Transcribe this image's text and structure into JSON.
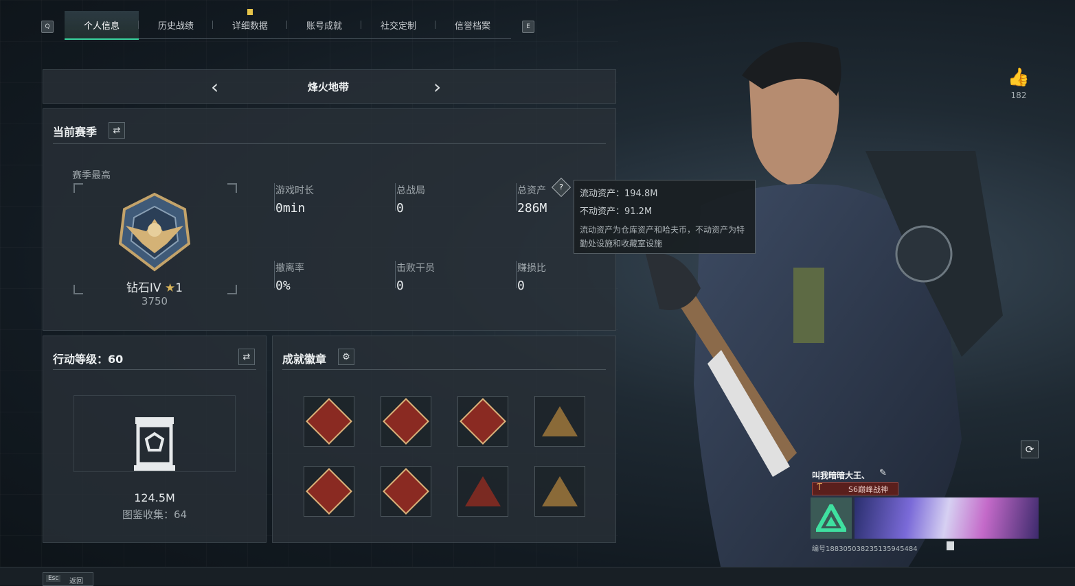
{
  "tabs": {
    "left_key": "Q",
    "right_key": "E",
    "items": [
      "个人信息",
      "历史战绩",
      "详细数据",
      "账号成就",
      "社交定制",
      "信誉档案"
    ],
    "active_index": 0
  },
  "mode_selector": {
    "title": "烽火地带"
  },
  "season": {
    "title": "当前赛季",
    "best_label": "赛季最高",
    "rank_name": "钻石IV",
    "rank_stars": "1",
    "rank_points": "3750",
    "stats": [
      {
        "label": "游戏时长",
        "value": "0min"
      },
      {
        "label": "总战局",
        "value": "0"
      },
      {
        "label": "总资产",
        "value": "286M"
      },
      {
        "label": "撤离率",
        "value": "0%"
      },
      {
        "label": "击败干员",
        "value": "0"
      },
      {
        "label": "赚损比",
        "value": "0"
      }
    ]
  },
  "tooltip": {
    "liquid": "流动资产：194.8M",
    "fixed": "不动资产：91.2M",
    "desc": "流动资产为仓库资产和哈夫币，不动资产为特勤处设施和收藏室设施"
  },
  "action_level": {
    "title": "行动等级：60",
    "value": "124.5M",
    "collection": "图鉴收集：64"
  },
  "badges": {
    "title": "成就徽章",
    "count": 8
  },
  "like": {
    "count": "182"
  },
  "profile": {
    "name": "叫我暗暗大王、",
    "title": "S6巅峰战神",
    "id_text": "编号188305038235135945484"
  },
  "footer": {
    "esc": "Esc",
    "back": "返回"
  },
  "colors": {
    "accent": "#39d6a0",
    "badge_red": "#8a2a22",
    "gold": "#d7b27a"
  }
}
